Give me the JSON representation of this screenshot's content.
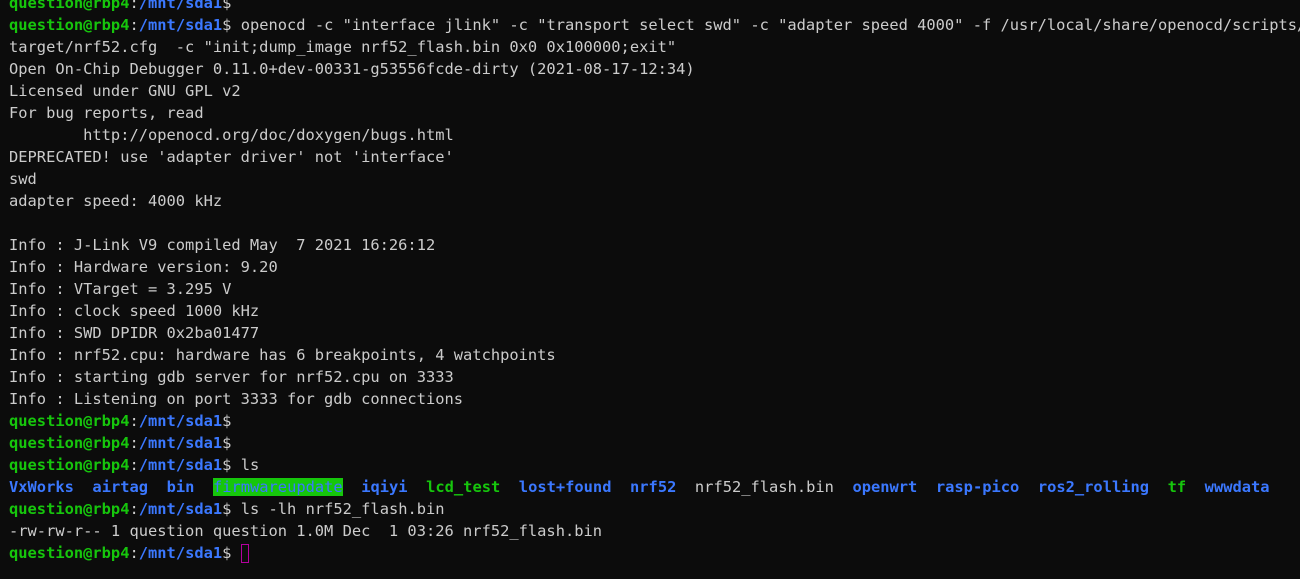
{
  "prompt": {
    "user": "question@rbp4",
    "colon": ":",
    "path": "/mnt/sda1",
    "symbol": "$"
  },
  "colors": {
    "background": "#0c0c0c",
    "text": "#cccccc",
    "prompt_user": "#16c60c",
    "prompt_path": "#3b78ff",
    "cursor": "#b4009e"
  },
  "lines": {
    "cmd1_a": " openocd -c \"interface jlink\" -c \"transport select swd\" -c \"adapter speed 4000\" -f /usr/local/share/openocd/scripts/",
    "cmd1_b": "target/nrf52.cfg  -c \"init;dump_image nrf52_flash.bin 0x0 0x100000;exit\"",
    "out1": "Open On-Chip Debugger 0.11.0+dev-00331-g53556fcde-dirty (2021-08-17-12:34)",
    "out2": "Licensed under GNU GPL v2",
    "out3": "For bug reports, read",
    "out4": "        http://openocd.org/doc/doxygen/bugs.html",
    "out5": "DEPRECATED! use 'adapter driver' not 'interface'",
    "out6": "swd",
    "out7": "adapter speed: 4000 kHz",
    "out8": "",
    "info1": "Info : J-Link V9 compiled May  7 2021 16:26:12",
    "info2": "Info : Hardware version: 9.20",
    "info3": "Info : VTarget = 3.295 V",
    "info4": "Info : clock speed 1000 kHz",
    "info5": "Info : SWD DPIDR 0x2ba01477",
    "info6": "Info : nrf52.cpu: hardware has 6 breakpoints, 4 watchpoints",
    "info7": "Info : starting gdb server for nrf52.cpu on 3333",
    "info8": "Info : Listening on port 3333 for gdb connections",
    "cmd_ls": " ls",
    "cmd_lslh": " ls -lh nrf52_flash.bin",
    "lslh_out": "-rw-rw-r-- 1 question question 1.0M Dec  1 03:26 nrf52_flash.bin"
  },
  "ls_entries": {
    "e1": "VxWorks",
    "e2": "airtag",
    "e3": "bin",
    "e4": "firmwareupdate",
    "e5": "iqiyi",
    "e6": "lcd_test",
    "e7": "lost+found",
    "e8": "nrf52",
    "e9": "nrf52_flash.bin",
    "e10": "openwrt",
    "e11": "rasp-pico",
    "e12": "ros2_rolling",
    "e13": "tf",
    "e14": "wwwdata"
  }
}
